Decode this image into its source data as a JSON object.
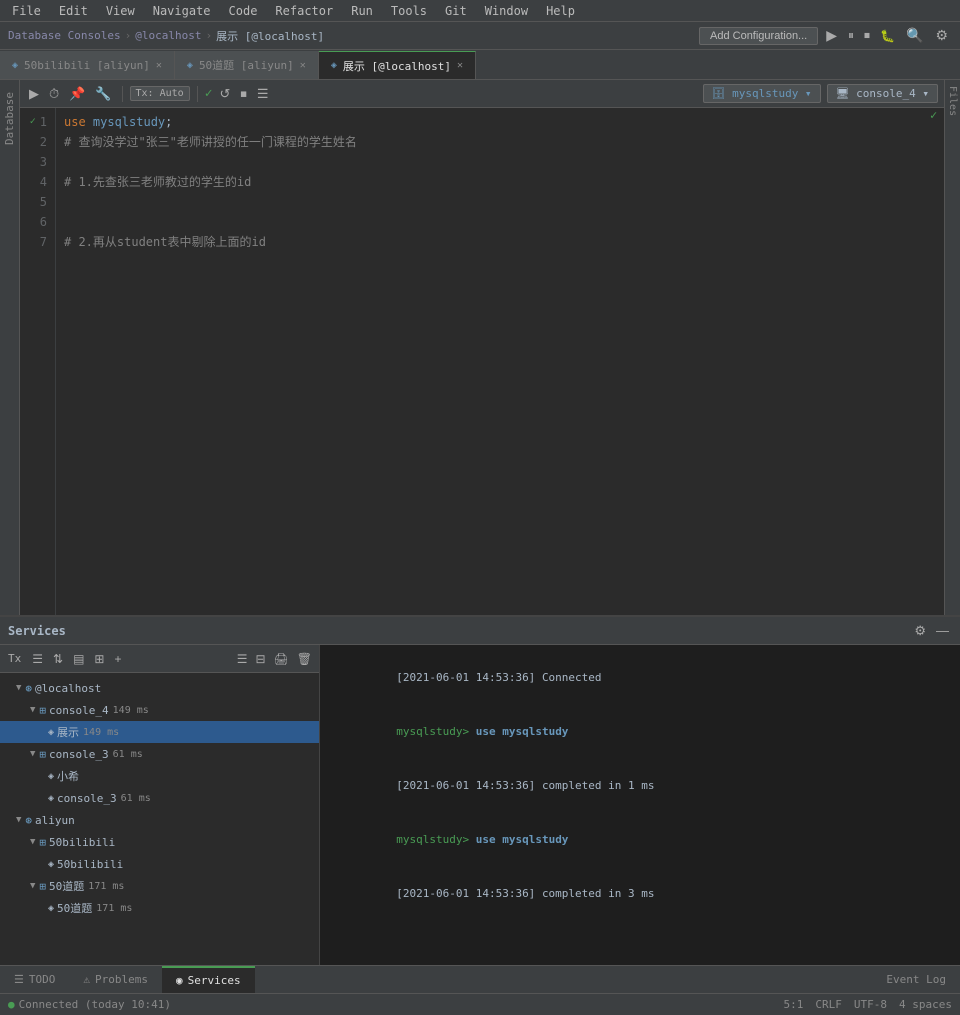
{
  "menubar": {
    "items": [
      "File",
      "Edit",
      "View",
      "Navigate",
      "Code",
      "Refactor",
      "Run",
      "Tools",
      "Git",
      "Window",
      "Help"
    ]
  },
  "breadcrumb": {
    "items": [
      "Database Consoles",
      "@localhost",
      "展示 [@localhost]"
    ]
  },
  "toolbar": {
    "add_config_label": "Add Configuration...",
    "tx_label": "Tx: Auto",
    "db_selector": "mysqlstudy",
    "console_selector": "console_4"
  },
  "tabs": [
    {
      "label": "50bilibili [aliyun]",
      "icon": "◈",
      "active": false
    },
    {
      "label": "50道题 [aliyun]",
      "icon": "◈",
      "active": false
    },
    {
      "label": "展示 [@localhost]",
      "icon": "◈",
      "active": true
    }
  ],
  "editor": {
    "lines": [
      {
        "num": 1,
        "check": true,
        "content": "use mysqlstudy;",
        "kw": "use",
        "id": "mysqlstudy"
      },
      {
        "num": 2,
        "content": "# 查询没学过\"张三\"老师讲授的任一门课程的学生姓名"
      },
      {
        "num": 3,
        "content": ""
      },
      {
        "num": 4,
        "content": "# 1.先查张三老师教过的学生的id"
      },
      {
        "num": 5,
        "content": ""
      },
      {
        "num": 6,
        "content": ""
      },
      {
        "num": 7,
        "content": "# 2.再从student表中剔除上面的id"
      }
    ]
  },
  "services": {
    "title": "Services",
    "tree": {
      "items": [
        {
          "label": "@localhost",
          "level": 1,
          "expanded": true,
          "icon": "db"
        },
        {
          "label": "console_4  149 ms",
          "level": 2,
          "expanded": true,
          "icon": "db"
        },
        {
          "label": "展示  149 ms",
          "level": 3,
          "selected": true,
          "icon": "file"
        },
        {
          "label": "console_3  61 ms",
          "level": 2,
          "expanded": true,
          "icon": "db"
        },
        {
          "label": "小希",
          "level": 3,
          "icon": "file"
        },
        {
          "label": "console_3  61 ms",
          "level": 3,
          "icon": "file"
        },
        {
          "label": "aliyun",
          "level": 1,
          "expanded": true,
          "icon": "db"
        },
        {
          "label": "50bilibili",
          "level": 2,
          "expanded": true,
          "icon": "db"
        },
        {
          "label": "50bilibili",
          "level": 3,
          "icon": "file"
        },
        {
          "label": "50道题  171 ms",
          "level": 2,
          "expanded": true,
          "icon": "db"
        },
        {
          "label": "50道题  171 ms",
          "level": 3,
          "icon": "file"
        }
      ]
    },
    "console": {
      "lines": [
        {
          "type": "timestamp",
          "text": "[2021-06-01 14:53:36] Connected"
        },
        {
          "type": "prompt",
          "cmd": "use mysqlstudy"
        },
        {
          "type": "timestamp",
          "text": "[2021-06-01 14:53:36] completed in 1 ms"
        },
        {
          "type": "prompt",
          "cmd": "use mysqlstudy"
        },
        {
          "type": "timestamp",
          "text": "[2021-06-01 14:53:36] completed in 3 ms"
        }
      ]
    }
  },
  "bottom_tabs": [
    {
      "label": "TODO",
      "icon": "≡",
      "active": false
    },
    {
      "label": "Problems",
      "icon": "⚠",
      "active": false
    },
    {
      "label": "Services",
      "icon": "◉",
      "active": true
    }
  ],
  "status_bar": {
    "connected": "Connected (today 10:41)",
    "position": "5:1",
    "line_ending": "CRLF",
    "encoding": "UTF-8",
    "indent": "4 spaces"
  },
  "event_log": "Event Log"
}
